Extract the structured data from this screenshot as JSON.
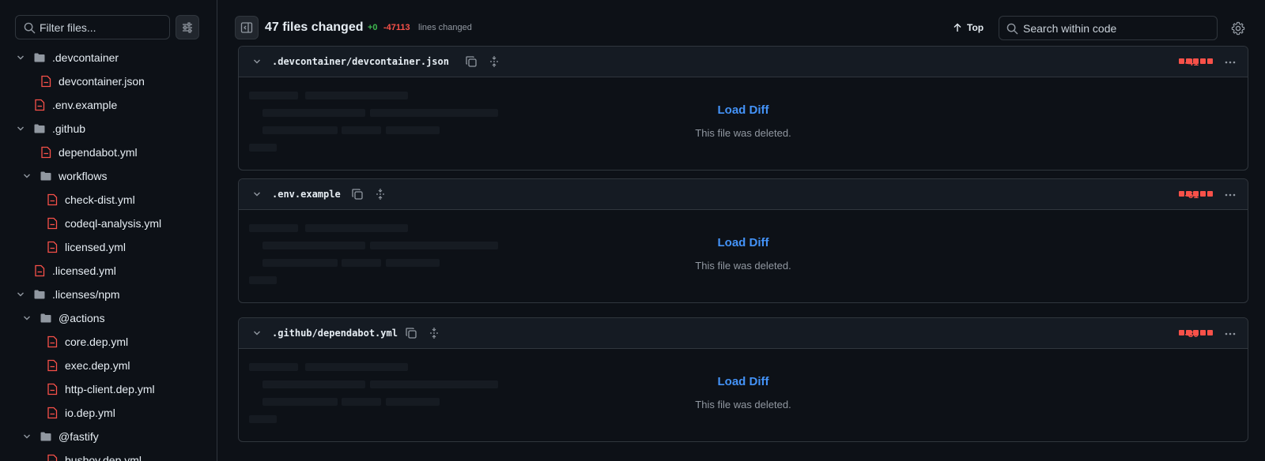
{
  "sidebar": {
    "filter_placeholder": "Filter files...",
    "tree": [
      {
        "label": ".devcontainer",
        "type": "folder",
        "depth": 0
      },
      {
        "label": "devcontainer.json",
        "type": "file",
        "depth": 1
      },
      {
        "label": ".env.example",
        "type": "file",
        "depth": 0
      },
      {
        "label": ".github",
        "type": "folder",
        "depth": 0
      },
      {
        "label": "dependabot.yml",
        "type": "file",
        "depth": 1
      },
      {
        "label": "workflows",
        "type": "folder",
        "depth": 1
      },
      {
        "label": "check-dist.yml",
        "type": "file",
        "depth": 2
      },
      {
        "label": "codeql-analysis.yml",
        "type": "file",
        "depth": 2
      },
      {
        "label": "licensed.yml",
        "type": "file",
        "depth": 2
      },
      {
        "label": ".licensed.yml",
        "type": "file",
        "depth": 0
      },
      {
        "label": ".licenses/npm",
        "type": "folder",
        "depth": 0
      },
      {
        "label": "@actions",
        "type": "folder",
        "depth": 1
      },
      {
        "label": "core.dep.yml",
        "type": "file",
        "depth": 2
      },
      {
        "label": "exec.dep.yml",
        "type": "file",
        "depth": 2
      },
      {
        "label": "http-client.dep.yml",
        "type": "file",
        "depth": 2
      },
      {
        "label": "io.dep.yml",
        "type": "file",
        "depth": 2
      },
      {
        "label": "@fastify",
        "type": "folder",
        "depth": 1
      },
      {
        "label": "busboy.dep.yml",
        "type": "file",
        "depth": 2
      }
    ]
  },
  "header": {
    "files_changed": "47 files changed",
    "additions": "+0",
    "deletions": "-47113",
    "lines_changed": "lines changed",
    "top_label": "Top",
    "search_placeholder": "Search within code"
  },
  "files": [
    {
      "name": ".devcontainer/devcontainer.json",
      "deletions": "-41",
      "load_label": "Load Diff",
      "message": "This file was deleted."
    },
    {
      "name": ".env.example",
      "deletions": "-61",
      "load_label": "Load Diff",
      "message": "This file was deleted."
    },
    {
      "name": ".github/dependabot.yml",
      "deletions": "-30",
      "load_label": "Load Diff",
      "message": "This file was deleted."
    }
  ],
  "colors": {
    "background": "#0d1117",
    "border": "#30363d",
    "addition": "#3fb950",
    "deletion": "#f85149",
    "link": "#4493f8",
    "muted": "#9198a1"
  }
}
